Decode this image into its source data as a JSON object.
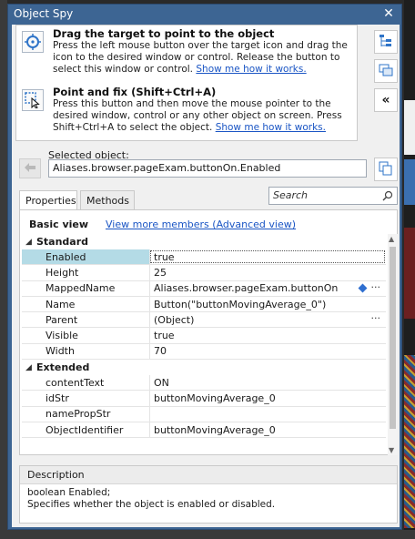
{
  "window": {
    "title": "Object Spy"
  },
  "modes": {
    "drag": {
      "title": "Drag the target to point to the object",
      "desc": "Press the left mouse button over the target icon and drag the icon to the desired window or control. Release the button to select this window or control.",
      "link": "Show me how it works."
    },
    "point": {
      "title": "Point and fix (Shift+Ctrl+A)",
      "desc": "Press this button and then move the mouse pointer to the desired window, control or any other object on screen. Press Shift+Ctrl+A to select the object.",
      "link": "Show me how it works."
    }
  },
  "selected": {
    "label": "Selected object:",
    "value": "Aliases.browser.pageExam.buttonOn.Enabled"
  },
  "tabs": [
    {
      "label": "Properties"
    },
    {
      "label": "Methods"
    }
  ],
  "search": {
    "placeholder": "Search"
  },
  "view": {
    "basic": "Basic view",
    "advanced_link": "View more members (Advanced view)"
  },
  "categories": {
    "standard": {
      "label": "Standard",
      "rows": [
        {
          "name": "Enabled",
          "value": "true"
        },
        {
          "name": "Height",
          "value": "25"
        },
        {
          "name": "MappedName",
          "value": "Aliases.browser.pageExam.buttonOn"
        },
        {
          "name": "Name",
          "value": "Button(\"buttonMovingAverage_0\")"
        },
        {
          "name": "Parent",
          "value": "(Object)"
        },
        {
          "name": "Visible",
          "value": "true"
        },
        {
          "name": "Width",
          "value": "70"
        }
      ]
    },
    "extended": {
      "label": "Extended",
      "rows": [
        {
          "name": "contentText",
          "value": "ON"
        },
        {
          "name": "idStr",
          "value": "buttonMovingAverage_0"
        },
        {
          "name": "namePropStr",
          "value": ""
        },
        {
          "name": "ObjectIdentifier",
          "value": "buttonMovingAverage_0"
        }
      ]
    }
  },
  "description": {
    "header": "Description",
    "line1": "boolean Enabled;",
    "line2": "Specifies whether the object is enabled or disabled."
  }
}
